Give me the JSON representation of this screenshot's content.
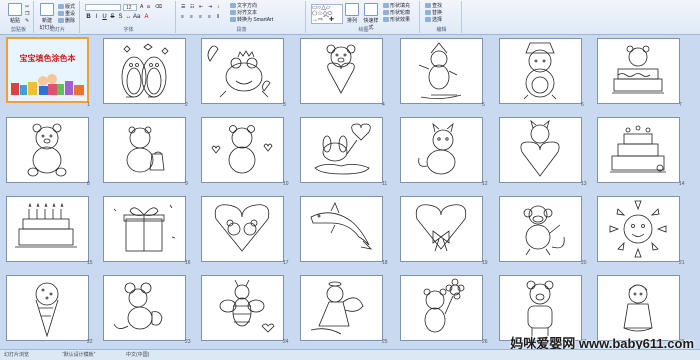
{
  "ribbon": {
    "groups": {
      "clipboard": "剪贴板",
      "slides": "幻灯片",
      "font": "字体",
      "paragraph": "段落",
      "drawing": "绘图",
      "editing": "编辑"
    },
    "buttons": {
      "paste": "粘贴",
      "new_slide": "新建",
      "new_slide_sub": "幻灯片",
      "layout": "版式",
      "reset": "重设",
      "delete": "删除",
      "font_size": "12",
      "text_direction": "文字方向",
      "align_text": "对齐文本",
      "smartart": "转换为 SmartArt",
      "shape_fill": "形状填充",
      "shape_outline": "形状轮廓",
      "shape_effects": "形状效果",
      "quick_styles": "快速样式",
      "arrange": "排列",
      "find": "查找",
      "replace": "替换",
      "select": "选择"
    }
  },
  "slides": {
    "title_slide_text": "宝宝填色涂色本",
    "numbers": [
      "1",
      "2",
      "3",
      "4",
      "5",
      "6",
      "7",
      "8",
      "9",
      "10",
      "11",
      "12",
      "13",
      "14",
      "15",
      "16",
      "17",
      "18",
      "19",
      "20",
      "21",
      "22",
      "23",
      "24",
      "25",
      "26",
      "27",
      "28"
    ]
  },
  "status": {
    "view": "幻灯片浏览",
    "theme": "“默认设计模板”",
    "language": "中文(中国)"
  },
  "watermark": "妈咪爱婴网 www.baby611.com"
}
